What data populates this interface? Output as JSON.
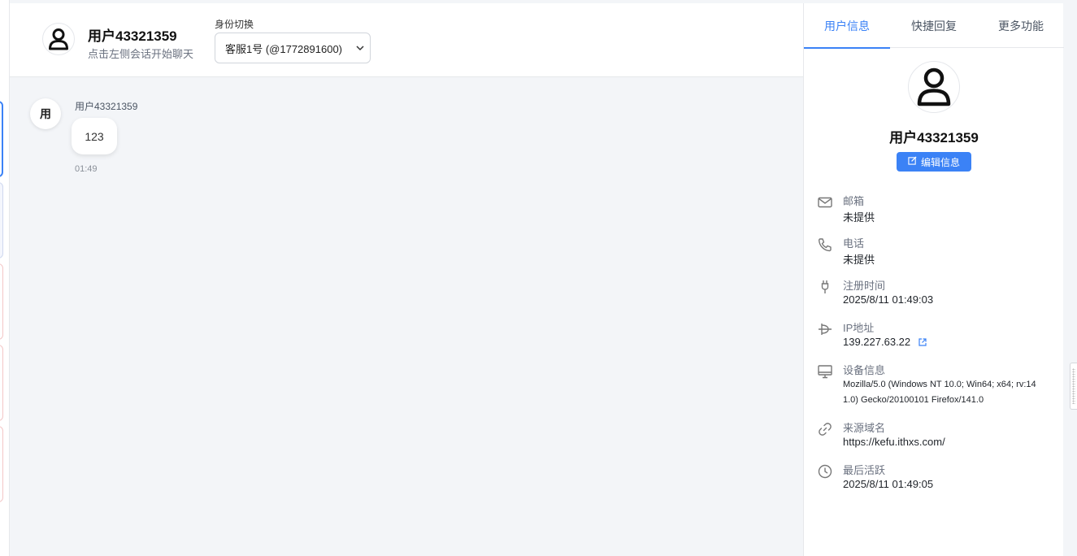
{
  "header": {
    "user_name": "用户43321359",
    "subtitle": "点击左侧会话开始聊天",
    "identity_label": "身份切换",
    "identity_selected": "客服1号 (@1772891600)"
  },
  "messages": [
    {
      "avatar_text": "用",
      "sender": "用户43321359",
      "text": "123",
      "time": "01:49"
    }
  ],
  "panel": {
    "tabs": [
      {
        "label": "用户信息",
        "active": true
      },
      {
        "label": "快捷回复",
        "active": false
      },
      {
        "label": "更多功能",
        "active": false
      }
    ],
    "profile_name": "用户43321359",
    "edit_label": "编辑信息",
    "info": [
      {
        "icon": "mail-icon",
        "label": "邮箱",
        "value": "未提供"
      },
      {
        "icon": "phone-icon",
        "label": "电话",
        "value": "未提供"
      },
      {
        "icon": "plug-icon",
        "label": "注册时间",
        "value": "2025/8/11 01:49:03"
      },
      {
        "icon": "network-icon",
        "label": "IP地址",
        "value": "139.227.63.22"
      },
      {
        "icon": "monitor-icon",
        "label": "设备信息",
        "value": "Mozilla/5.0 (Windows NT 10.0; Win64; x64; rv:141.0) Gecko/20100101 Firefox/141.0"
      },
      {
        "icon": "link-icon",
        "label": "来源域名",
        "value": "https://kefu.ithxs.com/"
      },
      {
        "icon": "clock-icon",
        "label": "最后活跃",
        "value": "2025/8/11 01:49:05"
      }
    ]
  },
  "colors": {
    "accent": "#3b82f6",
    "background": "#f3f5f8"
  }
}
